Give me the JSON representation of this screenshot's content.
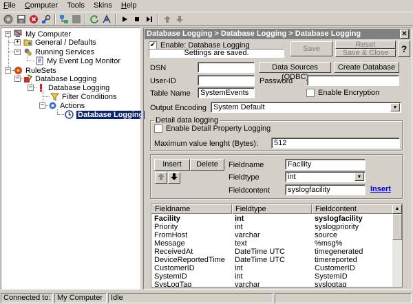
{
  "menu": [
    {
      "label": "File",
      "ul": "F",
      "rest": "ile"
    },
    {
      "label": "Computer",
      "ul": "C",
      "rest": "omputer"
    },
    {
      "label": "Tools",
      "ul": "",
      "rest": "Tools"
    },
    {
      "label": "Skins",
      "ul": "",
      "rest": "Skins"
    },
    {
      "label": "Help",
      "ul": "H",
      "rest": "elp"
    }
  ],
  "tree": {
    "root": "My Computer",
    "general": "General / Defaults",
    "running_services": "Running Services",
    "event_log_monitor": "My Event Log Monitor",
    "rulesets": "RuleSets",
    "ruleset_db": "Database Logging",
    "rule_db": "Database Logging",
    "filter_conditions": "Filter Conditions",
    "actions": "Actions",
    "action_db": "Database Logging"
  },
  "panel": {
    "title": "Database Logging > Database Logging > Database Logging",
    "enable_label": "Enable: Database Logging",
    "status_msg": "Settings are saved.",
    "save": "Save",
    "reset": "Reset",
    "save_close": "Save & Close",
    "help": "?"
  },
  "form": {
    "dsn_label": "DSN",
    "dsn_value": "",
    "data_sources_btn": "Data Sources (ODBC)",
    "create_db_btn": "Create Database",
    "userid_label": "User-ID",
    "userid_value": "",
    "password_label": "Password",
    "password_value": "",
    "table_label": "Table Name",
    "table_value": "SystemEvents",
    "encryption_label": "Enable Encryption",
    "output_label": "Output Encoding",
    "output_value": "System Default"
  },
  "detail": {
    "caption": "Detail data logging",
    "property_logging_label": "Enable Detail Property Logging",
    "maxlen_label": "Maximum value lenght (Bytes):",
    "maxlen_value": "512"
  },
  "field_editor": {
    "insert_btn": "Insert",
    "delete_btn": "Delete",
    "fieldname_label": "Fieldname",
    "fieldname_value": "Facility",
    "fieldtype_label": "Fieldtype",
    "fieldtype_value": "int",
    "fieldcontent_label": "Fieldcontent",
    "fieldcontent_value": "syslogfacility",
    "insert_link": "Insert"
  },
  "grid": {
    "headers": [
      "Fieldname",
      "Fieldtype",
      "Fieldcontent"
    ],
    "rows": [
      [
        "Facility",
        "int",
        "syslogfacility"
      ],
      [
        "Priority",
        "int",
        "syslogpriority"
      ],
      [
        "FromHost",
        "varchar",
        "source"
      ],
      [
        "Message",
        "text",
        "%msg%"
      ],
      [
        "ReceivedAt",
        "DateTime UTC",
        "timegenerated"
      ],
      [
        "DeviceReportedTime",
        "DateTime UTC",
        "timereported"
      ],
      [
        "CustomerID",
        "int",
        "CustomerID"
      ],
      [
        "SystemID",
        "int",
        "SystemID"
      ],
      [
        "SysLogTag",
        "varchar",
        "syslogtag"
      ]
    ]
  },
  "status": {
    "connected_label": "Connected to:",
    "computer": "My Computer",
    "state": "Idle"
  }
}
